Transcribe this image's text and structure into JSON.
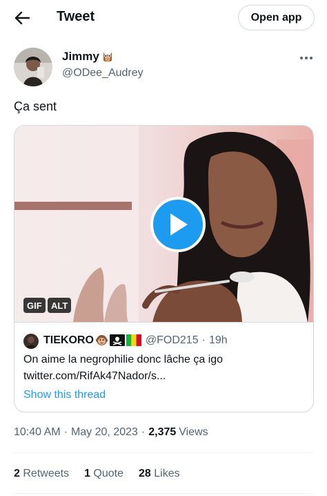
{
  "header": {
    "title": "Tweet",
    "open_app_label": "Open app"
  },
  "tweet": {
    "author": {
      "name": "Jimmy",
      "handle": "@ODee_Audrey"
    },
    "text": "Ça sent",
    "media": {
      "gif_label": "GIF",
      "alt_label": "ALT"
    },
    "quote": {
      "name": "TIEKORO",
      "handle": "@FOD215",
      "separator": "·",
      "time": "19h",
      "line1": "On aime la negrophilie donc lâche ça igo",
      "line2": "twitter.com/RifAk47Nador/s...",
      "show_thread": "Show this thread"
    },
    "meta": {
      "time": "10:40 AM",
      "date": "May 20, 2023",
      "views_count": "2,375",
      "views_label": "Views"
    },
    "stats": {
      "retweets_count": "2",
      "retweets_label": "Retweets",
      "quotes_count": "1",
      "quotes_label": "Quote",
      "likes_count": "28",
      "likes_label": "Likes"
    }
  },
  "colors": {
    "accent": "#1d9bf0",
    "text": "#0f1419",
    "secondary": "#536471",
    "border": "#cfd9de"
  }
}
